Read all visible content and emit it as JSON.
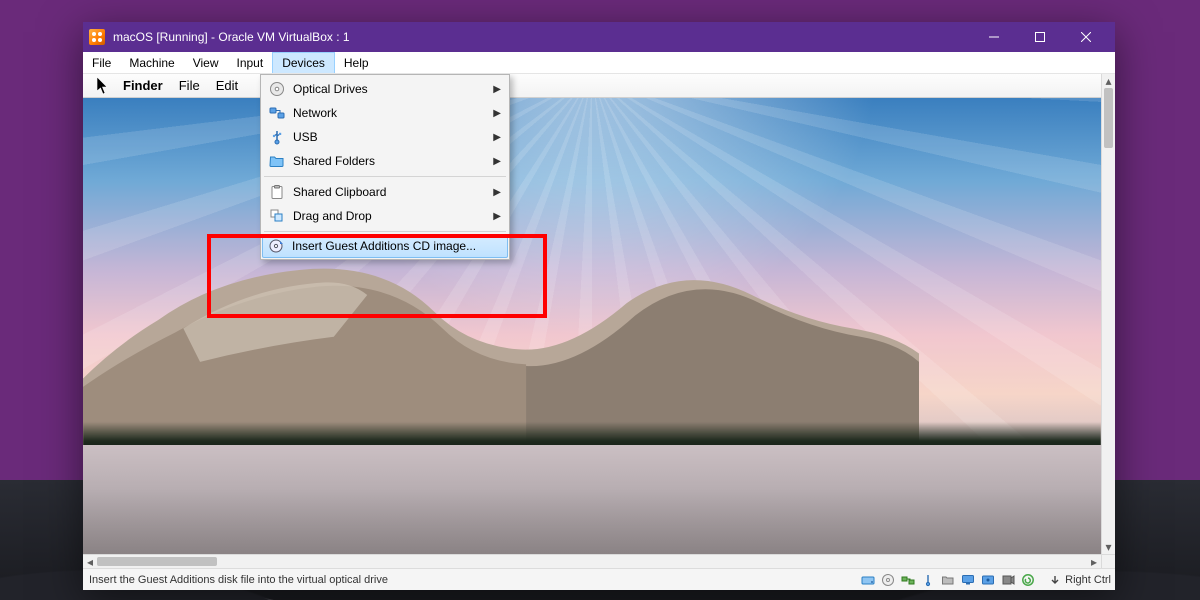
{
  "window": {
    "title": "macOS [Running] - Oracle VM VirtualBox : 1"
  },
  "menubar": {
    "items": [
      "File",
      "Machine",
      "View",
      "Input",
      "Devices",
      "Help"
    ],
    "open_index": 4
  },
  "guest_menubar": {
    "finder": "Finder",
    "items": [
      "File",
      "Edit"
    ]
  },
  "devices_menu": {
    "items": [
      {
        "label": "Optical Drives",
        "icon": "disc",
        "submenu": true
      },
      {
        "label": "Network",
        "icon": "network",
        "submenu": true
      },
      {
        "label": "USB",
        "icon": "usb",
        "submenu": true
      },
      {
        "label": "Shared Folders",
        "icon": "folder",
        "submenu": true
      }
    ],
    "items2": [
      {
        "label": "Shared Clipboard",
        "icon": "clipboard",
        "submenu": true
      },
      {
        "label": "Drag and Drop",
        "icon": "drag",
        "submenu": true
      }
    ],
    "highlighted": {
      "label": "Insert Guest Additions CD image...",
      "icon": "cd-insert"
    }
  },
  "statusbar": {
    "hint": "Insert the Guest Additions disk file into the virtual optical drive",
    "hostkey": "Right Ctrl"
  }
}
